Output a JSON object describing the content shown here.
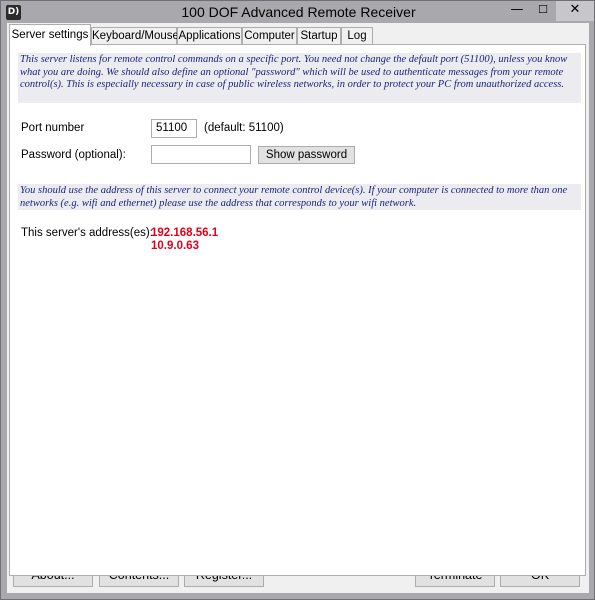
{
  "window": {
    "title": "100 DOF Advanced Remote Receiver",
    "icon_label": "D)",
    "controls": {
      "minimize": "—",
      "maximize": "☐",
      "close": "✕"
    }
  },
  "tabs": [
    {
      "label": "Server settings",
      "active": true
    },
    {
      "label": "Keyboard/Mouse",
      "active": false
    },
    {
      "label": "Applications",
      "active": false
    },
    {
      "label": "Computer",
      "active": false
    },
    {
      "label": "Startup",
      "active": false
    },
    {
      "label": "Log",
      "active": false
    }
  ],
  "server_settings": {
    "intro_text": "This server listens for remote control commands on a specific port. You need not change the default port (51100), unless you know what you are doing. We should also define an optional \"password\" which will be used to authenticate messages from your remote control(s). This is especially necessary in case of public wireless networks, in order to protect your PC from unauthorized access.",
    "port_label": "Port number",
    "port_value": "51100",
    "port_default_note": "(default: 51100)",
    "password_label": "Password (optional):",
    "password_value": "",
    "show_password_label": "Show password",
    "address_note": "You should use the address of this server to connect your remote control device(s). If your computer is connected to more than one networks (e.g. wifi and ethernet) please use the address that corresponds to your wifi network.",
    "address_label": "This server's address(es):",
    "addresses": [
      "192.168.56.1",
      "10.9.0.63"
    ]
  },
  "footer": {
    "about_label": "About...",
    "contents_label": "Contents...",
    "register_label": "Register...",
    "terminate_label": "Terminate",
    "ok_label": "OK"
  },
  "colors": {
    "titlebar": "#a9a9ad",
    "info_text": "#1a237e",
    "address_text": "#e0001a"
  }
}
